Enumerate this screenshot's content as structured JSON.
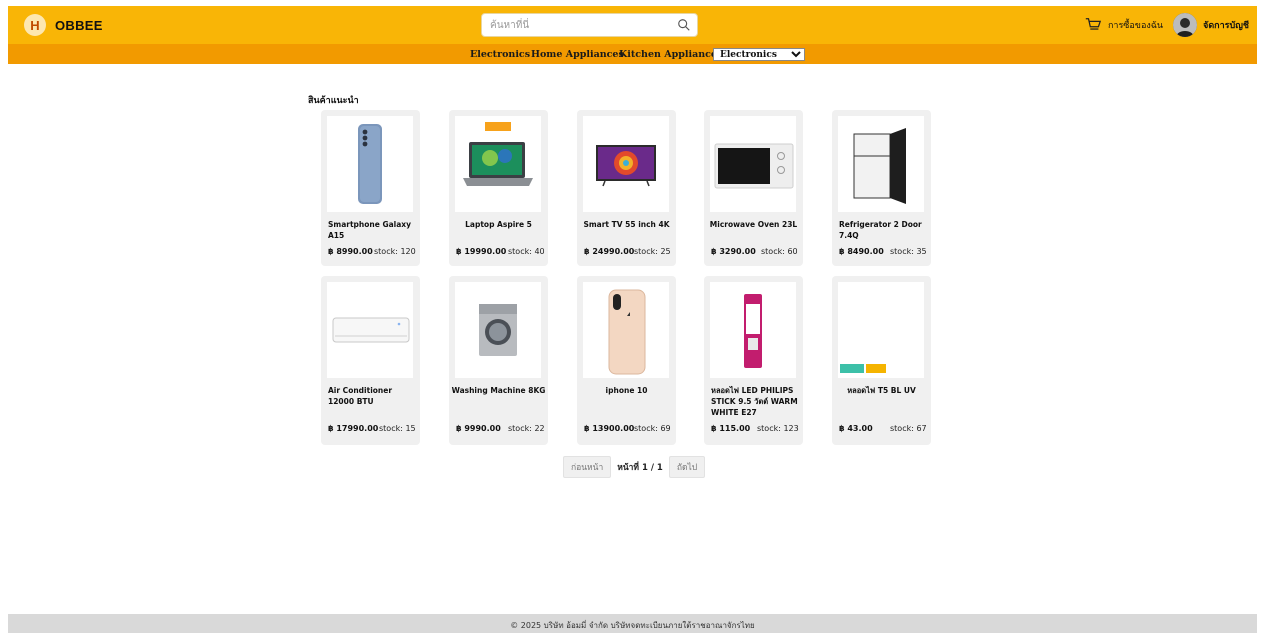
{
  "header": {
    "logo_letter": "H",
    "brand": "OBBEE",
    "search_placeholder": "ค้นหาที่นี่",
    "orders_label": "การซื้อของฉัน",
    "account_label": "จัดการบัญชี"
  },
  "categories": {
    "links": [
      "Electronics",
      "Home Appliances",
      "Kitchen Appliances"
    ],
    "select_value": "Electronics"
  },
  "section_title": "สินค้าแนะนำ",
  "products": [
    {
      "name": "Smartphone Galaxy A15",
      "price": "฿ 8990.00",
      "stock": "stock: 120"
    },
    {
      "name": "Laptop Aspire 5",
      "price": "฿ 19990.00",
      "stock": "stock: 40"
    },
    {
      "name": "Smart TV 55 inch 4K",
      "price": "฿ 24990.00",
      "stock": "stock: 25"
    },
    {
      "name": "Microwave Oven 23L",
      "price": "฿ 3290.00",
      "stock": "stock: 60"
    },
    {
      "name": "Refrigerator 2 Door 7.4Q",
      "price": "฿ 8490.00",
      "stock": "stock: 35"
    },
    {
      "name": "Air Conditioner 12000 BTU",
      "price": "฿ 17990.00",
      "stock": "stock: 15"
    },
    {
      "name": "Washing Machine 8KG",
      "price": "฿ 9990.00",
      "stock": "stock: 22"
    },
    {
      "name": "iphone 10",
      "price": "฿ 13900.00",
      "stock": "stock: 69"
    },
    {
      "name": "หลอดไฟ LED PHILIPS STICK 9.5 วัตต์ WARM WHITE E27",
      "price": "฿ 115.00",
      "stock": "stock: 123"
    },
    {
      "name": "หลอดไฟ T5 BL UV",
      "price": "฿ 43.00",
      "stock": "stock: 67"
    }
  ],
  "pagination": {
    "prev_label": "ก่อนหน้า",
    "page_info": "หน้าที่ 1 / 1",
    "next_label": "ถัดไป"
  },
  "footer": {
    "text": "© 2025 บริษัท อ้อมมี่ จำกัด บริษัทจดทะเบียนภายใต้ราชอาณาจักรไทย"
  },
  "colors": {
    "topbar": "#f9b506",
    "catbar": "#f29a00",
    "card": "#f0f0f0",
    "footer": "#d9d9d9"
  }
}
